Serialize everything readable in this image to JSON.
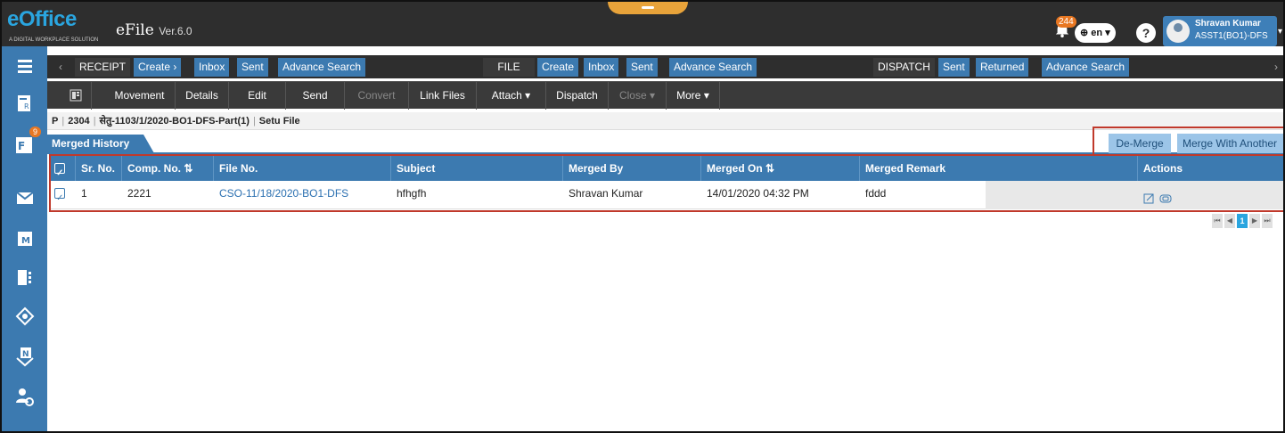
{
  "header": {
    "logo_text": "eOffice",
    "logo_tagline": "A DIGITAL WORKPLACE SOLUTION",
    "app_name": "eFile",
    "version": "Ver.6.0",
    "notification_count": "244",
    "language": "en",
    "help_label": "?",
    "user_name": "Shravan Kumar",
    "user_role": "ASST1(BO1)-DFS"
  },
  "sidebar": {
    "file_badge": "9",
    "items": [
      "receipt-icon",
      "file-icon",
      "dak-icon",
      "meeting-icon",
      "dsc-icon",
      "eOffice-home-icon",
      "notice-icon",
      "settings-icon"
    ]
  },
  "modules": {
    "receipt": {
      "label": "RECEIPT",
      "create": "Create ›",
      "inbox": "Inbox",
      "sent": "Sent",
      "advance_search": "Advance Search"
    },
    "file": {
      "label": "FILE",
      "create": "Create",
      "inbox": "Inbox",
      "sent": "Sent",
      "advance_search": "Advance Search"
    },
    "dispatch": {
      "label": "DISPATCH",
      "sent": "Sent",
      "returned": "Returned",
      "advance_search": "Advance Search"
    }
  },
  "actions": {
    "movement": "Movement",
    "details": "Details",
    "edit": "Edit",
    "send": "Send",
    "convert": "Convert",
    "link_files": "Link Files",
    "attach": "Attach ▾",
    "dispatch": "Dispatch",
    "close": "Close ▾",
    "more": "More ▾"
  },
  "breadcrumb": {
    "type": "P",
    "number": "2304",
    "file_no": "सेतु-1103/1/2020-BO1-DFS-Part(1)",
    "file_type": "Setu File"
  },
  "merged_history": {
    "tab_label": "Merged History",
    "de_merge": "De-Merge",
    "merge_with_another": "Merge With Another",
    "columns": [
      "Sr. No.",
      "Comp. No. ⇅",
      "File No.",
      "Subject",
      "Merged By",
      "Merged On ⇅",
      "Merged Remark",
      "Actions"
    ],
    "rows": [
      {
        "sr_no": "1",
        "comp_no": "2221",
        "file_no": "CSO-11/18/2020-BO1-DFS",
        "subject": "hfhgfh",
        "merged_by": "Shravan Kumar",
        "merged_on": "14/01/2020 04:32 PM",
        "remark": "fddd"
      }
    ]
  },
  "pager": {
    "current_page": "1"
  },
  "colors": {
    "primary": "#3c7ab0",
    "header_bg": "#2e2e2e",
    "accent": "#e87722",
    "highlight": "#c0392b"
  }
}
